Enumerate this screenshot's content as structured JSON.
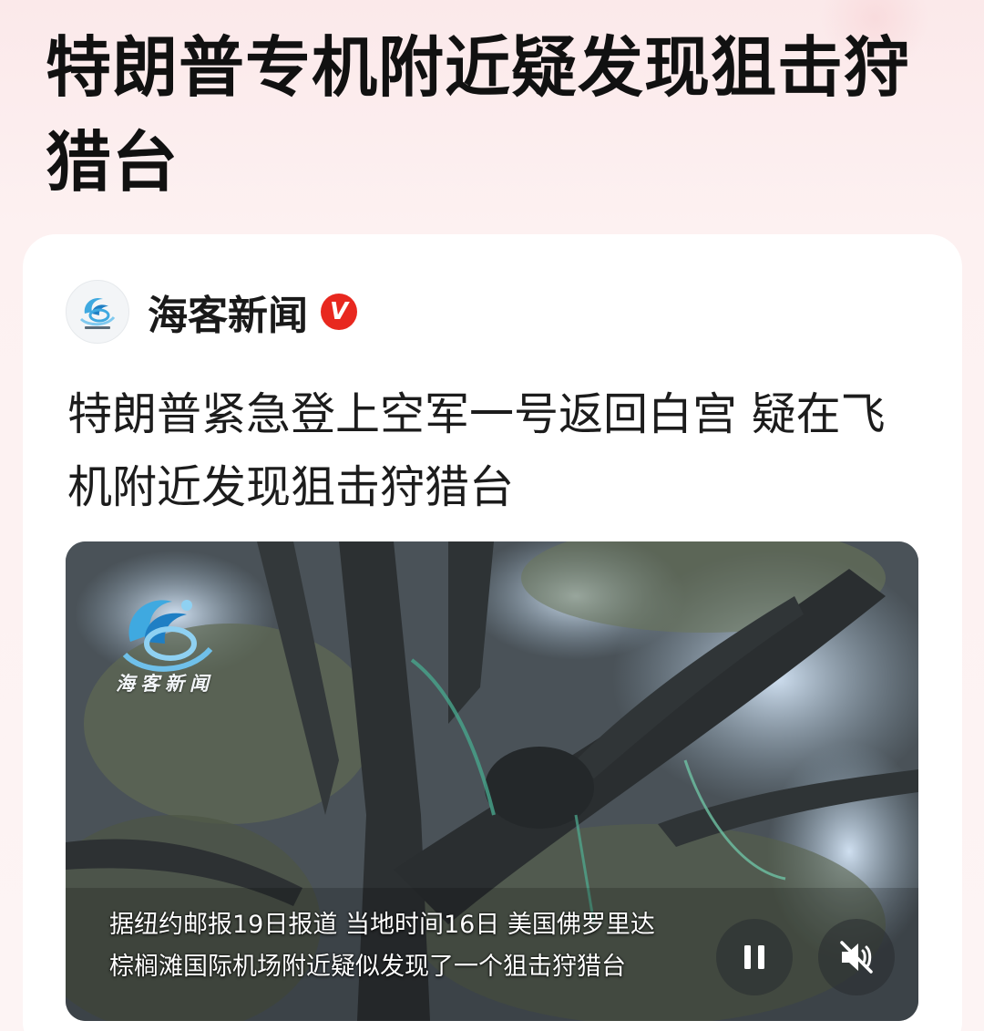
{
  "page": {
    "title": "特朗普专机附近疑发现狙击狩猎台"
  },
  "article": {
    "source_name": "海客新闻",
    "verified_badge": "V",
    "headline": "特朗普紧急登上空军一号返回白宫 疑在飞机附近发现狙击狩猎台"
  },
  "video": {
    "watermark_text": "海客新闻",
    "subtitle_line1": "据纽约邮报19日报道 当地时间16日 美国佛罗里达",
    "subtitle_line2": "棕榈滩国际机场附近疑似发现了一个狙击狩猎台",
    "pause_icon": "pause-icon",
    "mute_icon": "mute-icon"
  },
  "colors": {
    "badge_red": "#e8281f",
    "logo_blue": "#3fa9e0"
  }
}
